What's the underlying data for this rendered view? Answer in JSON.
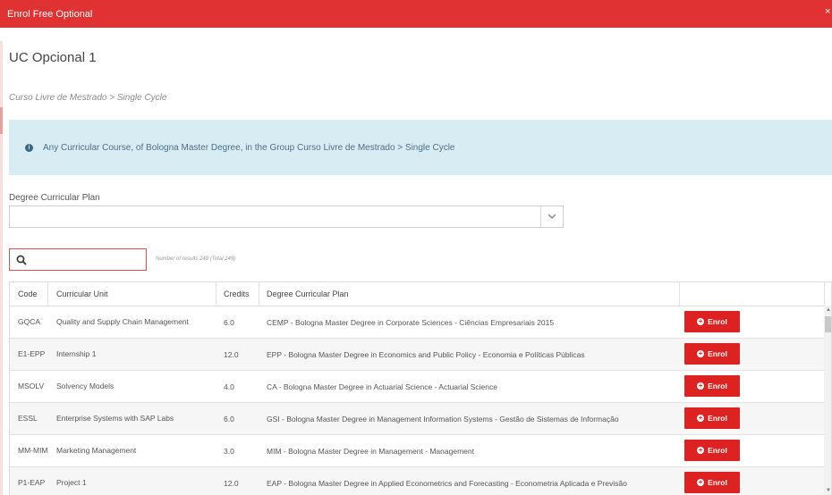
{
  "window": {
    "title": "Enrol Free Optional",
    "close_label": "×"
  },
  "heading": "UC Opcional 1",
  "breadcrumb": "Curso Livre de Mestrado > Single Cycle",
  "info_message": "Any Curricular Course, of Bologna Master Degree, in the Group Curso Livre de Mestrado > Single Cycle",
  "filter": {
    "label": "Degree Curricular Plan",
    "selected_value": ""
  },
  "search": {
    "value": "",
    "results_text": "Number of results 249 (Total 249)"
  },
  "table": {
    "headers": {
      "code": "Code",
      "unit": "Curricular Unit",
      "credits": "Credits",
      "plan": "Degree Curricular Plan"
    },
    "enrol_label": "Enrol",
    "rows": [
      {
        "code": "GQCA",
        "unit": "Quality and Supply Chain Management",
        "credits": "6.0",
        "plan": "CEMP - Bologna Master Degree in Corporate Sciences - Ciências Empresariais 2015"
      },
      {
        "code": "E1-EPP",
        "unit": "Internship 1",
        "credits": "12.0",
        "plan": "EPP - Bologna Master Degree in Economics and Public Policy - Economia e Políticas Públicas"
      },
      {
        "code": "MSOLV",
        "unit": "Solvency Models",
        "credits": "4.0",
        "plan": "CA - Bologna Master Degree in Actuarial Science - Actuarial Science"
      },
      {
        "code": "ESSL",
        "unit": "Enterprise Systems with SAP Labs",
        "credits": "6.0",
        "plan": "GSI - Bologna Master Degree in Management Information Systems - Gestão de Sistemas de Informação"
      },
      {
        "code": "MM-MIM",
        "unit": "Marketing Management",
        "credits": "3.0",
        "plan": "MIM - Bologna Master Degree in Management - Management"
      },
      {
        "code": "P1-EAP",
        "unit": "Project 1",
        "credits": "12.0",
        "plan": "EAP - Bologna Master Degree in Applied Econometrics and Forecasting - Econometria Aplicada e Previsão"
      }
    ]
  },
  "colors": {
    "accent": "#e03232",
    "enrol_button": "#dd2222",
    "info_bg": "#d8ecf4"
  }
}
